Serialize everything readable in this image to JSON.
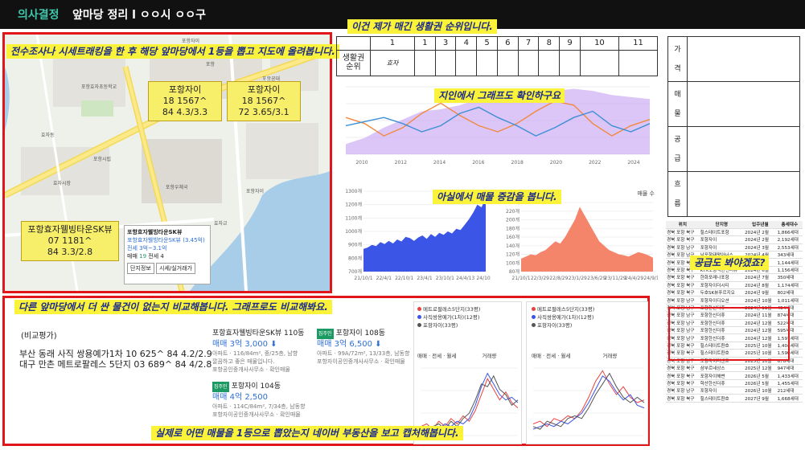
{
  "header": {
    "brand": "의사결정",
    "title": "앞마당 정리 l ㅇㅇ시 ㅇㅇ구"
  },
  "annotations": {
    "map": "전수조사나 시세트래킹을 한 후 해당 앞마당에서 1등을 뽑고 지도에 올려봅니다.",
    "ranking": "이건 제가 매긴 생활권 순위입니다.",
    "graph": "지인에서 그래프도 확인하구요",
    "listings": "아실에서 매물 증감을 봅니다.",
    "supply": "공급도 봐야겠죠?",
    "compare": "다른 앞마당에서 더 싼 물건이 없는지 비교해봅니다. 그래프로도 비교해봐요.",
    "naver": "실제로 어떤 매물을 1등으로 뽑았는지 네이버 부동산을 보고 캡처해봅니다."
  },
  "map": {
    "boxes": [
      {
        "name": "포항자이",
        "l1": "18 1567^",
        "l2": "84 4.3/3.3"
      },
      {
        "name": "포항자이",
        "l1": "18 1567^",
        "l2": "72 3.65/3.1"
      },
      {
        "name": "포항효자웰빙타운SK뷰",
        "l1": "07 1181^",
        "l2": "84 3.3/2.8"
      }
    ],
    "labels": [
      "포항자이",
      "포항효자초등학교",
      "효자동",
      "포항공대",
      "효자시장",
      "포항자이",
      "포항우체국",
      "효자교",
      "포항시립",
      "포항"
    ],
    "card": {
      "title": "포항효자웰빙타운SK뷰",
      "link": "포항효자웰빙타운SK뷰 (3.45억)",
      "price": "전세 3억~3.1억",
      "stats_label": "매매",
      "stats_count": "19",
      "stats_extra": "전세 4",
      "btn1": "단지정보",
      "btn2": "시세/실거래가"
    }
  },
  "grid": {
    "header": [
      "1",
      "1",
      "3",
      "4",
      "5",
      "6",
      "7",
      "8",
      "9",
      "10",
      "11"
    ],
    "row_label": "생활권\n순위",
    "first_cell": "효자"
  },
  "side_table": {
    "rows": [
      "가격",
      "매물",
      "공급",
      "흐름"
    ]
  },
  "chart_data": [
    {
      "type": "line",
      "title": "",
      "x": [
        "2010",
        "2012",
        "2014",
        "2016",
        "2018",
        "2020",
        "2022",
        "2024"
      ],
      "series": [
        {
          "values": [
            3.3,
            3.0,
            2.4,
            2.8,
            3.5,
            4.0,
            3.4,
            2.9,
            2.6,
            3.0,
            3.6,
            4.1,
            3.9,
            3.0,
            2.4,
            2.9,
            3.2
          ]
        },
        {
          "values": [
            2.9,
            3.1,
            3.3,
            3.0,
            2.6,
            2.9,
            3.5,
            3.8,
            3.3,
            2.9,
            2.4,
            2.8,
            3.3,
            3.6,
            2.9,
            2.6,
            3.0
          ]
        }
      ],
      "area_values": [
        2.0,
        2.3,
        2.8,
        3.2,
        3.6,
        3.7,
        3.9,
        4.2,
        4.3,
        4.3,
        4.4,
        4.6,
        4.7,
        4.6,
        4.4,
        4.3,
        4.2
      ]
    },
    {
      "type": "area",
      "title": "",
      "ylabel": "",
      "x": [
        "21/10/1",
        "22/4/1",
        "22/10/1",
        "23/4/1",
        "23/10/1",
        "24/4/13",
        "24/10/1"
      ],
      "yticks": [
        "1300개",
        "1200개",
        "1100개",
        "1000개",
        "900개",
        "800개",
        "700개"
      ],
      "ylim": [
        700,
        1300
      ],
      "values": [
        870,
        880,
        900,
        890,
        920,
        905,
        930,
        910,
        940,
        925,
        960,
        950,
        930,
        955,
        970,
        945,
        980,
        960,
        990,
        975,
        1000,
        985,
        1020,
        1010,
        1050,
        1090,
        1140,
        1200,
        1180,
        1250
      ]
    },
    {
      "type": "area",
      "title": "",
      "legend": "매물 수",
      "x": [
        "21/10/1",
        "22/3/29",
        "22/8/29",
        "23/1/29",
        "23/6/29",
        "23/11/29",
        "24/4/29",
        "24/9/19"
      ],
      "yticks": [
        "240개",
        "220개",
        "200개",
        "180개",
        "160개",
        "140개",
        "120개",
        "100개",
        "80개"
      ],
      "ylim": [
        80,
        240
      ],
      "values": [
        110,
        115,
        120,
        118,
        125,
        130,
        140,
        150,
        145,
        160,
        180,
        200,
        230,
        210,
        190,
        170,
        150,
        140,
        130,
        125,
        120,
        118,
        115,
        120,
        125,
        122,
        118,
        112
      ]
    },
    {
      "type": "line",
      "title": "",
      "series": [
        {
          "name": "사직쌍용예가(1차)(12평)",
          "values": [
            1.0,
            1.1,
            0.9,
            1.2,
            1.0,
            1.3,
            1.1,
            1.4,
            1.2,
            1.6,
            2.2,
            2.8,
            2.4,
            2.0,
            2.3,
            1.9,
            1.7
          ]
        },
        {
          "name": "포항자이(33평)",
          "values": [
            0.8,
            0.9,
            1.0,
            0.9,
            1.1,
            1.0,
            1.2,
            1.1,
            1.3,
            1.8,
            2.5,
            3.0,
            2.6,
            2.2,
            2.0,
            2.1,
            1.9
          ]
        },
        {
          "name": "만촌메트로팔레스5단지(33평)",
          "values": [
            0.9,
            0.8,
            1.0,
            1.1,
            0.9,
            1.2,
            1.0,
            1.3,
            1.5,
            2.0,
            2.6,
            2.5,
            2.9,
            2.4,
            2.2,
            1.8,
            2.0
          ]
        }
      ]
    },
    {
      "type": "line",
      "title": "",
      "series": [
        {
          "name": "메트로팔레스5단지(33평)",
          "values": [
            1.1,
            1.2,
            1.0,
            1.3,
            1.2,
            1.4,
            1.3,
            1.6,
            2.1,
            2.7,
            3.1,
            2.6,
            2.2,
            2.5,
            2.1,
            1.9,
            2.0
          ]
        },
        {
          "name": "사직쌍용예가(1차)(12평)",
          "values": [
            0.9,
            1.0,
            1.1,
            1.0,
            1.2,
            1.1,
            1.3,
            1.5,
            1.9,
            2.4,
            2.9,
            2.7,
            2.3,
            2.0,
            2.2,
            1.8,
            1.7
          ]
        },
        {
          "name": "포항자이(33평)",
          "values": [
            1.0,
            0.9,
            1.2,
            1.1,
            1.0,
            1.3,
            1.4,
            1.3,
            1.7,
            2.2,
            2.6,
            3.0,
            2.5,
            2.1,
            1.9,
            2.1,
            1.9
          ]
        }
      ]
    }
  ],
  "compare": {
    "label": "(비교평가)",
    "line1": "부산 동래 사직 쌍용예가1차 10 625^ 84 4.2/2.9",
    "line2": "대구 만촌 메트로팔레스 5단지 03 689^ 84 4/2.8"
  },
  "naver": {
    "listings": [
      {
        "name": "포항효자웰빙타운SK뷰 110동",
        "badge": "",
        "price": "매매 3억 3,000",
        "sub": "아파트 · 116/84m², 중/25층, 남향",
        "sub2": "깔끔하고 좋은 매물입니다.",
        "agent": "포항공인중개사사무소 · 확인매물"
      },
      {
        "name": "포항자이 108동",
        "badge": "집주인",
        "price": "매매 3억 6,500",
        "sub": "아파트 · 99A/72m², 13/33층, 남동향",
        "sub2": "",
        "agent": "포항자이공인중개사사무소 · 확인매물"
      },
      {
        "name": "포항자이 104동",
        "badge": "집주인",
        "price": "매매 4억 2,500",
        "sub": "아파트 · 114C/84m², 7/34층, 남동향",
        "sub2": "",
        "agent": "포항자이공인중개사사무소 · 확인매물"
      }
    ],
    "chart1_legend": [
      "메트로팔레스5단지(33평)",
      "사직쌍용예가(1차)(12평)",
      "포항자이(33평)"
    ],
    "chart2_legend": [
      "메트로팔레스5단지(33평)",
      "사직쌍용예가(1차)(12평)",
      "포항자이(33평)"
    ],
    "toggle": [
      "매매",
      "전세",
      "월세"
    ],
    "toggle_extra": "거래량"
  },
  "transactions": {
    "columns": [
      "위치",
      "단지명",
      "입주년월",
      "총세대수"
    ],
    "rows": [
      [
        "경북 포항 북구",
        "힐스테이트포항",
        "2024년 2월",
        "1,866세대"
      ],
      [
        "경북 포항 북구",
        "포항자이",
        "2024년 2월",
        "2,192세대"
      ],
      [
        "경북 포항 남구",
        "포항자이",
        "2024년 3월",
        "2,553세대"
      ],
      [
        "경북 포항 남구",
        "남포항태왕아너스",
        "2024년 4월",
        "343세대"
      ],
      [
        "경북 포항 북구",
        "포항자이",
        "2024년 5월",
        "1,144세대"
      ],
      [
        "경북 포항 북구",
        "KTX포항역한신더휴",
        "2024년 6월",
        "1,156세대"
      ],
      [
        "경북 포항 북구",
        "한화포레나포항",
        "2024년 7월",
        "350세대"
      ],
      [
        "경북 포항 북구",
        "포항자이더시티",
        "2024년 8월",
        "1,174세대"
      ],
      [
        "경북 포항 북구",
        "두호SK뷰푸르지오",
        "2024년 9월",
        "802세대"
      ],
      [
        "경북 포항 남구",
        "포항자이디오션",
        "2024년 10월",
        "1,011세대"
      ],
      [
        "경북 포항 남구",
        "포항한신더휴",
        "2024년 11월",
        "454세대"
      ],
      [
        "경북 포항 남구",
        "포항한신더휴",
        "2024년 11월",
        "874세대"
      ],
      [
        "경북 포항 남구",
        "포항한신더휴",
        "2024년 12월",
        "522세대"
      ],
      [
        "경북 포항 남구",
        "포항한신더휴",
        "2024년 12월",
        "595세대"
      ],
      [
        "경북 포항 남구",
        "포항한신더휴",
        "2024년 12월",
        "1,597세대"
      ],
      [
        "경북 포항 북구",
        "힐스테이트환호",
        "2025년 10월",
        "1,404세대"
      ],
      [
        "경북 포항 북구",
        "힐스테이트환호",
        "2025년 10월",
        "1,590세대"
      ],
      [
        "경북 포항 남구",
        "포항자이더센트",
        "2025년 10월",
        "678세대"
      ],
      [
        "경북 포항 북구",
        "삼부르네상스",
        "2025년 12월",
        "947세대"
      ],
      [
        "경북 포항 북구",
        "포항자이해변",
        "2026년 5월",
        "1,433세대"
      ],
      [
        "경북 포항 북구",
        "학산한신더휴",
        "2026년 5월",
        "1,455세대"
      ],
      [
        "경북 포항 남구",
        "포항자이",
        "2026년 10월",
        "212세대"
      ],
      [
        "경북 포항 북구",
        "힐스테이트환호",
        "2027년 9월",
        "1,668세대"
      ]
    ]
  },
  "colors": {
    "red_box": "#e1161a",
    "tag_bg": "#fbf23a",
    "tag_fg": "#1b2b8c",
    "brand": "#3fc7ad",
    "blue_area": "#3b55e6",
    "salmon_area": "#f4856a",
    "price_blue": "#2d6fd4"
  }
}
